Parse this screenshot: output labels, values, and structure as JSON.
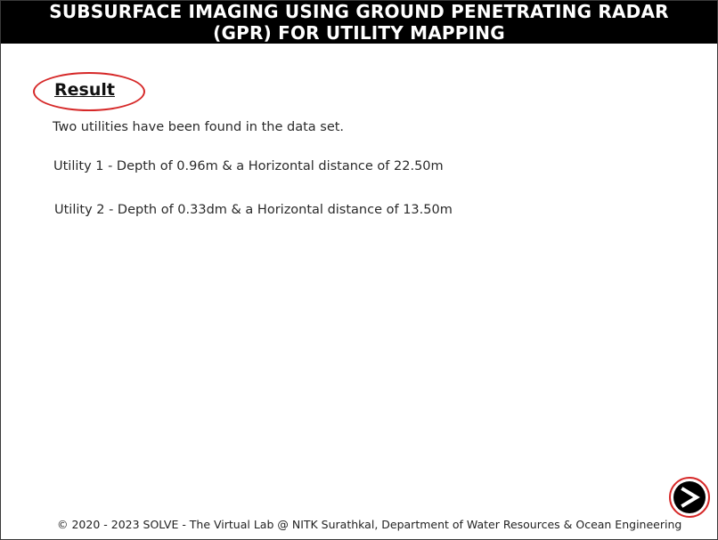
{
  "header": {
    "title_line1": "SUBSURFACE IMAGING USING GROUND PENETRATING RADAR",
    "title_line2": "(GPR) FOR UTILITY MAPPING"
  },
  "result": {
    "heading": "Result",
    "summary": "Two utilities have been found in the data set.",
    "utilities": [
      {
        "text": "Utility 1 - Depth of 0.96m & a Horizontal distance of 22.50m"
      },
      {
        "text": "Utility 2 - Depth of 0.33dm & a Horizontal distance of 13.50m"
      }
    ]
  },
  "navigation": {
    "next_icon": "next-arrow-icon"
  },
  "footer": {
    "text": "© 2020 - 2023 SOLVE - The Virtual Lab @ NITK Surathkal, Department of Water Resources & Ocean Engineering"
  },
  "colors": {
    "header_bg": "#000000",
    "header_text": "#ffffff",
    "highlight_ring": "#d62828"
  }
}
